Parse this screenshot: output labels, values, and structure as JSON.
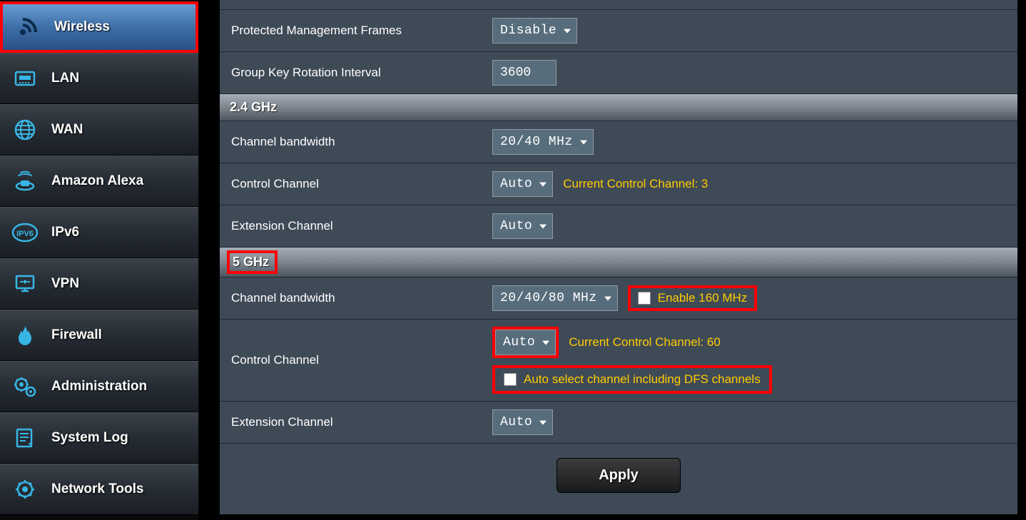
{
  "sidebar": {
    "items": [
      {
        "id": "wireless",
        "label": "Wireless"
      },
      {
        "id": "lan",
        "label": "LAN"
      },
      {
        "id": "wan",
        "label": "WAN"
      },
      {
        "id": "alexa",
        "label": "Amazon Alexa"
      },
      {
        "id": "ipv6",
        "label": "IPv6"
      },
      {
        "id": "vpn",
        "label": "VPN"
      },
      {
        "id": "firewall",
        "label": "Firewall"
      },
      {
        "id": "admin",
        "label": "Administration"
      },
      {
        "id": "syslog",
        "label": "System Log"
      },
      {
        "id": "nettools",
        "label": "Network Tools"
      }
    ]
  },
  "top_rows": {
    "pmf": {
      "label": "Protected Management Frames",
      "value": "Disable"
    },
    "gkri": {
      "label": "Group Key Rotation Interval",
      "value": "3600"
    }
  },
  "band24": {
    "header": "2.4 GHz",
    "cbw": {
      "label": "Channel bandwidth",
      "value": "20/40 MHz"
    },
    "ctrl": {
      "label": "Control Channel",
      "value": "Auto",
      "hint": "Current Control Channel: 3"
    },
    "ext": {
      "label": "Extension Channel",
      "value": "Auto"
    }
  },
  "band5": {
    "header": "5 GHz",
    "cbw": {
      "label": "Channel bandwidth",
      "value": "20/40/80 MHz",
      "chk_label": "Enable 160 MHz"
    },
    "ctrl": {
      "label": "Control Channel",
      "value": "Auto",
      "hint": "Current Control Channel: 60",
      "dfs_label": "Auto select channel including DFS channels"
    },
    "ext": {
      "label": "Extension Channel",
      "value": "Auto"
    }
  },
  "apply_label": "Apply"
}
